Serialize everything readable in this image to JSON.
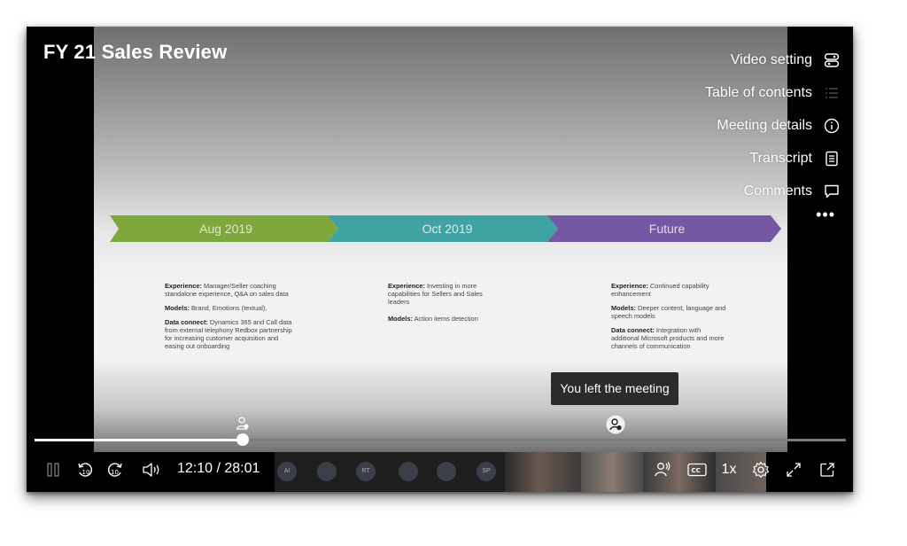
{
  "video": {
    "title": "FY 21 Sales Review",
    "time_display": "12:10 / 28:01",
    "progress": 0.257,
    "speed": "1x"
  },
  "side_menu": [
    {
      "label": "Video setting",
      "icon": "settings-toggle-icon"
    },
    {
      "label": "Table of contents",
      "icon": "list-icon"
    },
    {
      "label": "Meeting details",
      "icon": "info-icon"
    },
    {
      "label": "Transcript",
      "icon": "document-icon"
    },
    {
      "label": "Comments",
      "icon": "comment-icon"
    }
  ],
  "slide": {
    "timeline": [
      {
        "label": "Aug 2019",
        "color": "#7ea83b"
      },
      {
        "label": "Oct 2019",
        "color": "#3fa3a1"
      },
      {
        "label": "Future",
        "color": "#7458a3"
      }
    ],
    "columns": [
      {
        "items": [
          {
            "heading": "Experience:",
            "text": " Manager/Seller coaching standalone experience, Q&A on sales data"
          },
          {
            "heading": "Models:",
            "text": " Brand, Emotions (textual),"
          },
          {
            "heading": "Data connect:",
            "text": " Dynamics 365 and Call data from external telephony Redbox partnership for increasing customer acquisition and easing out onboarding"
          }
        ]
      },
      {
        "items": [
          {
            "heading": "Experience:",
            "text": " Investing in more capabilities for Sellers and Sales leaders"
          },
          {
            "heading": "Models:",
            "text": " Action items detection"
          }
        ]
      },
      {
        "items": [
          {
            "heading": "Experience:",
            "text": " Continued capability enhancement"
          },
          {
            "heading": "Models:",
            "text": " Deeper content, language and speech models"
          },
          {
            "heading": "Data connect:",
            "text": " Integration with additional Microsoft products and more channels of communication"
          }
        ]
      }
    ]
  },
  "tooltip": "You left the meeting",
  "participants": [
    "AI",
    "",
    "RT",
    "",
    "",
    "SP"
  ]
}
